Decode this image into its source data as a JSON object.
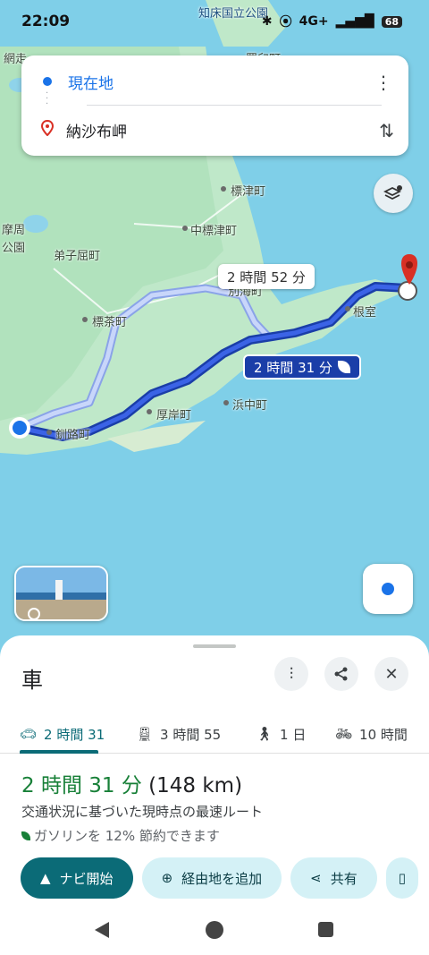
{
  "status_bar": {
    "time": "22:09",
    "network": "4G+",
    "battery": "68"
  },
  "route_card": {
    "origin": "現在地",
    "destination": "納沙布岬"
  },
  "map": {
    "labels": {
      "park_top": "知床国立公園",
      "abashiri": "網走",
      "rausu": "羅臼町",
      "shibetsu": "標津町",
      "naka_shibetsu": "中標津町",
      "teshikaga": "弟子屈町",
      "shibecha": "標茶町",
      "betsukai": "別海町",
      "nemuro": "根室",
      "akkeshi": "厚岸町",
      "hamanaka": "浜中町",
      "kushiro": "釧路町",
      "park_left_1": "摩周",
      "park_left_2": "公園"
    },
    "alt_route_label": "2 時間 52 分",
    "main_route_label": "2 時間 31 分"
  },
  "sheet": {
    "title": "車",
    "tabs": [
      {
        "label": "2 時間 31",
        "icon": "car-icon",
        "active": true
      },
      {
        "label": "3 時間 55",
        "icon": "train-icon",
        "active": false
      },
      {
        "label": "1 日",
        "icon": "walk-icon",
        "active": false
      },
      {
        "label": "10 時間",
        "icon": "bike-icon",
        "active": false
      }
    ],
    "duration": "2 時間 31 分",
    "distance": "(148 km)",
    "description": "交通状況に基づいた現時点の最速ルート",
    "eco_note": "ガソリンを 12% 節約できます",
    "actions": {
      "start": "ナビ開始",
      "add_stop": "経由地を追加",
      "share": "共有"
    }
  },
  "colors": {
    "accent": "#0b6b77",
    "route": "#1a3ea8",
    "time_green": "#188038",
    "water": "#7fcfe8",
    "land": "#b8e6c2"
  }
}
